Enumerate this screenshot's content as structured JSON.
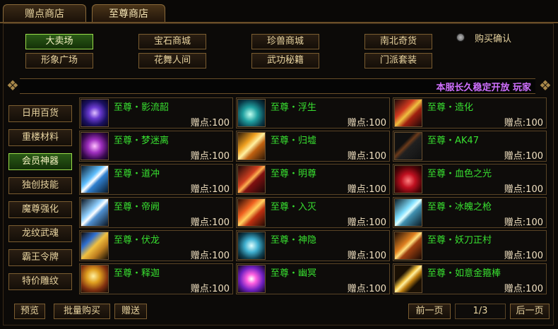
{
  "tabs": [
    {
      "label": "赠点商店",
      "active": false
    },
    {
      "label": "至尊商店",
      "active": true
    }
  ],
  "categories": [
    {
      "label": "大卖场",
      "active": true
    },
    {
      "label": "宝石商城",
      "active": false
    },
    {
      "label": "珍兽商城",
      "active": false
    },
    {
      "label": "南北奇货",
      "active": false
    },
    {
      "label": "形象广场",
      "active": false
    },
    {
      "label": "花舞人间",
      "active": false
    },
    {
      "label": "武功秘籍",
      "active": false
    },
    {
      "label": "门派套装",
      "active": false
    }
  ],
  "purchase_confirm_label": "购买确认",
  "marquee_text": "本服长久稳定开放 玩家",
  "side_menu": [
    {
      "label": "日用百货",
      "active": false
    },
    {
      "label": "重楼材料",
      "active": false
    },
    {
      "label": "会员神器",
      "active": true
    },
    {
      "label": "独创技能",
      "active": false
    },
    {
      "label": "魔尊强化",
      "active": false
    },
    {
      "label": "龙纹武魂",
      "active": false
    },
    {
      "label": "霸王令牌",
      "active": false
    },
    {
      "label": "特价雕纹",
      "active": false
    }
  ],
  "items": [
    {
      "name": "至尊・影流韶",
      "price": "赠点:100",
      "icon": "purple-blue-orb-icon"
    },
    {
      "name": "至尊・浮生",
      "price": "赠点:100",
      "icon": "cyan-feather-orb-icon"
    },
    {
      "name": "至尊・造化",
      "price": "赠点:100",
      "icon": "golden-red-staff-icon"
    },
    {
      "name": "至尊・梦迷离",
      "price": "赠点:100",
      "icon": "violet-orb-icon"
    },
    {
      "name": "至尊・归墟",
      "price": "赠点:100",
      "icon": "golden-winged-sword-icon"
    },
    {
      "name": "至尊・AK47",
      "price": "赠点:100",
      "icon": "rifle-icon"
    },
    {
      "name": "至尊・道冲",
      "price": "赠点:100",
      "icon": "ice-blue-blade-icon"
    },
    {
      "name": "至尊・明尊",
      "price": "赠点:100",
      "icon": "red-dark-blade-icon"
    },
    {
      "name": "至尊・血色之光",
      "price": "赠点:100",
      "icon": "crimson-spear-icon"
    },
    {
      "name": "至尊・帝阙",
      "price": "赠点:100",
      "icon": "white-blue-blade-icon"
    },
    {
      "name": "至尊・入灭",
      "price": "赠点:100",
      "icon": "golden-flame-blade-icon"
    },
    {
      "name": "至尊・冰魄之枪",
      "price": "赠点:100",
      "icon": "ice-gun-icon"
    },
    {
      "name": "至尊・伏龙",
      "price": "赠点:100",
      "icon": "golden-dragon-staff-icon"
    },
    {
      "name": "至尊・神隐",
      "price": "赠点:100",
      "icon": "cyan-lightning-blade-icon"
    },
    {
      "name": "至尊・妖刀正村",
      "price": "赠点:100",
      "icon": "orange-katana-icon"
    },
    {
      "name": "至尊・释迦",
      "price": "赠点:100",
      "icon": "golden-ring-staff-icon"
    },
    {
      "name": "至尊・幽冥",
      "price": "赠点:100",
      "icon": "purple-pink-orb-icon"
    },
    {
      "name": "至尊・如意金箍棒",
      "price": "赠点:100",
      "icon": "golden-rod-icon"
    }
  ],
  "bottom": {
    "preview": "预览",
    "batch_buy": "批量购买",
    "gift": "赠送",
    "prev_page": "前一页",
    "page_info": "1/3",
    "next_page": "后一页"
  },
  "colors": {
    "active_green": "#2a5a16",
    "item_name_green": "#38e030",
    "marquee_purple": "#d070ff",
    "border_gold": "#7a5c30"
  }
}
